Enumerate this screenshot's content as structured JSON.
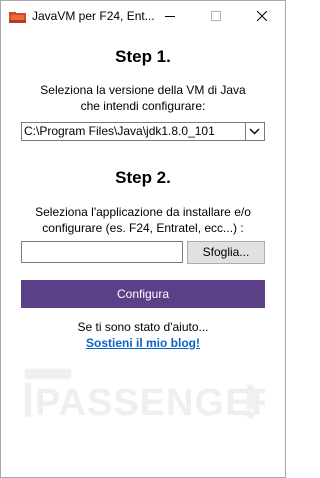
{
  "window": {
    "title": "JavaVM per F24, Ent...",
    "icon": "folder-icon",
    "controls": [
      "minimize-icon",
      "maximize-icon",
      "close-icon"
    ]
  },
  "step1": {
    "heading": "Step 1.",
    "description_line1": "Seleziona la versione della VM di Java",
    "description_line2": "che intendi configurare:",
    "select_value": "C:\\Program Files\\Java\\jdk1.8.0_101"
  },
  "step2": {
    "heading": "Step 2.",
    "description_line1": "Seleziona l'applicazione da installare e/o",
    "description_line2": "configurare (es. F24, Entratel, ecc...) :",
    "path_value": "",
    "browse_label": "Sfoglia..."
  },
  "actions": {
    "configure_label": "Configura"
  },
  "support": {
    "text": "Se ti sono stato d'aiuto...",
    "link_label": "Sostieni il mio blog!"
  },
  "watermark": {
    "text": "PASSENGER"
  },
  "colors": {
    "accent": "#5b3f87",
    "link": "#0a64c9",
    "folder": "#d9482b"
  }
}
